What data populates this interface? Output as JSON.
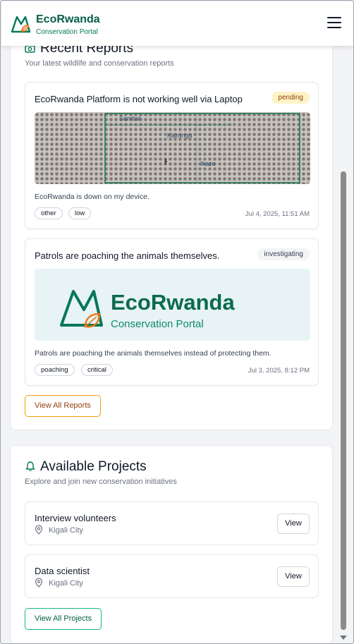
{
  "header": {
    "brand_name": "EcoRwanda",
    "brand_sub": "Conservation Portal"
  },
  "recent_reports": {
    "title": "Recent Reports",
    "subtitle": "Your latest wildlife and conservation reports",
    "icon": "camera-icon",
    "reports": [
      {
        "title": "EcoRwanda Platform is not working well via Laptop",
        "status": "pending",
        "description": "EcoRwanda is down on my device.",
        "tags": [
          "other",
          "low"
        ],
        "date": "Jul 4, 2025, 11:51 AM",
        "image_text": [
          "Sambal",
          "Kazungu",
          "Ikaze"
        ]
      },
      {
        "title": "Patrols are poaching the animals themselves.",
        "status": "investigating",
        "description": "Patrols are poaching the animals themselves instead of protecting them.",
        "tags": [
          "poaching",
          "critical"
        ],
        "date": "Jul 3, 2025, 8:12 PM",
        "image_brand": "EcoRwanda",
        "image_sub": "Conservation Portal"
      }
    ],
    "view_all_label": "View All Reports"
  },
  "available_projects": {
    "title": "Available Projects",
    "subtitle": "Explore and join new conservation initiatives",
    "icon": "bell-icon",
    "projects": [
      {
        "title": "Interview volunteers",
        "location": "Kigali City",
        "view_label": "View"
      },
      {
        "title": "Data scientist",
        "location": "Kigali City",
        "view_label": "View"
      }
    ],
    "view_all_label": "View All Projects"
  },
  "colors": {
    "brand_green": "#065f46",
    "accent_orange": "#f59e0b",
    "pending_bg": "#fef3c7"
  }
}
